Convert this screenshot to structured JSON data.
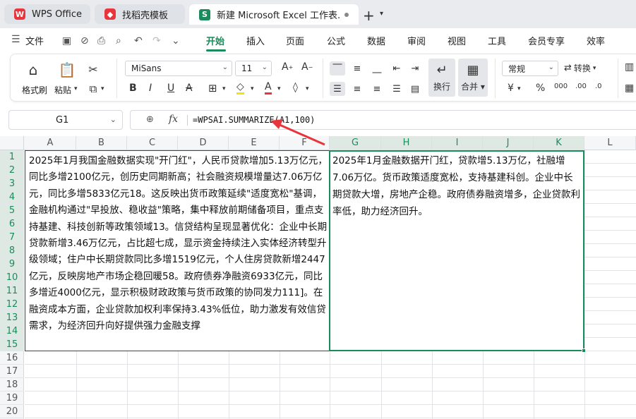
{
  "tabs": [
    {
      "label": "WPS Office",
      "icon": "wps-logo"
    },
    {
      "label": "找稻壳模板",
      "icon": "docer-logo"
    },
    {
      "label": "新建 Microsoft Excel 工作表.",
      "icon": "spreadsheet-icon",
      "icon_letter": "S"
    }
  ],
  "menu": {
    "file": "文件",
    "items": [
      "开始",
      "插入",
      "页面",
      "公式",
      "数据",
      "审阅",
      "视图",
      "工具",
      "会员专享",
      "效率"
    ],
    "active": "开始"
  },
  "ribbon": {
    "format_painter": "格式刷",
    "paste": "粘贴",
    "font_name": "MiSans",
    "font_size": "11",
    "wrap_text": "换行",
    "merge": "合并",
    "number_format": "常规",
    "convert": "转换",
    "currency_symbol": "¥",
    "percent_symbol": "%"
  },
  "formula_bar": {
    "cell_ref": "G1",
    "fx": "fx",
    "formula": "=WPSAI.SUMMARIZE(A1,100)"
  },
  "columns": [
    "A",
    "B",
    "C",
    "D",
    "E",
    "F",
    "G",
    "H",
    "I",
    "J",
    "K",
    "L"
  ],
  "rows": [
    "1",
    "2",
    "3",
    "4",
    "5",
    "6",
    "7",
    "8",
    "9",
    "10",
    "11",
    "12",
    "13",
    "14",
    "15",
    "16",
    "17",
    "18",
    "19",
    "20"
  ],
  "cells": {
    "A1": "2025年1月我国金融数据实现\"开门红\"，人民币贷款增加5.13万亿元，同比多增2100亿元，创历史同期新高；社会融资规模增量达7.06万亿元，同比多增5833亿元18。这反映出货币政策延续\"适度宽松\"基调，金融机构通过\"早投放、稳收益\"策略，集中释放前期储备项目，重点支持基建、科技创新等政策领域13。信贷结构呈现显著优化：企业中长期贷款新增3.46万亿元，占比超七成，显示资金持续注入实体经济转型升级领域；住户中长期贷款同比多增1519亿元，个人住房贷款新增2447亿元，反映房地产市场企稳回暖58。政府债券净融资6933亿元，同比多增近4000亿元，显示积极财政政策与货币政策的协同发力111]。在融资成本方面，企业贷款加权利率保持3.43%低位，助力激发有效信贷需求，为经济回升向好提供强力金融支撑",
    "G1": "2025年1月金融数据开门红，贷款增5.13万亿，社融增7.06万亿。货币政策适度宽松，支持基建科创。企业中长期贷款大增，房地产企稳。政府债券融资增多，企业贷款利率低，助力经济回升。"
  }
}
